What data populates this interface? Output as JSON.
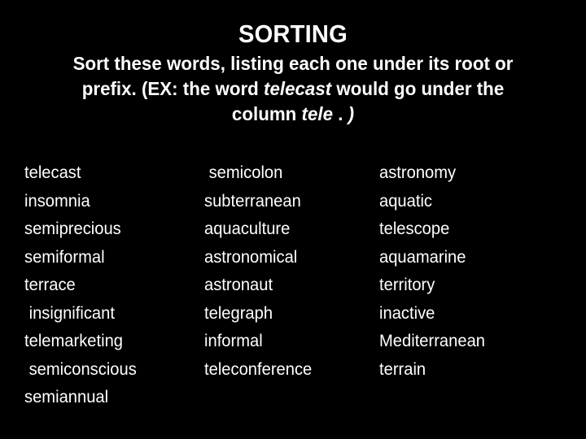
{
  "slide": {
    "title": "SORTING",
    "background_color": "#000000",
    "text_color": "#ffffff",
    "subtitle_lines": [
      {
        "segments": [
          {
            "text": "Sort these words, listing each one under its root or",
            "italic": false
          }
        ]
      },
      {
        "segments": [
          {
            "text": "prefix.  (EX: the word ",
            "italic": false
          },
          {
            "text": "telecast",
            "italic": true
          },
          {
            "text": " would go under the",
            "italic": false
          }
        ]
      },
      {
        "segments": [
          {
            "text": "column ",
            "italic": false
          },
          {
            "text": "tele",
            "italic": true
          },
          {
            "text": " . ",
            "italic": false
          },
          {
            "text": ")",
            "italic": true
          }
        ]
      }
    ]
  },
  "columns": [
    {
      "id": "column-1",
      "words": [
        "telecast",
        "insomnia",
        "semiprecious",
        "semiformal",
        "terrace",
        " insignificant",
        "telemarketing",
        " semiconscious",
        "semiannual"
      ]
    },
    {
      "id": "column-2",
      "words": [
        " semicolon",
        "subterranean",
        "aquaculture",
        "astronomical",
        "astronaut",
        "telegraph",
        "informal",
        "teleconference"
      ]
    },
    {
      "id": "column-3",
      "words": [
        "astronomy",
        "aquatic",
        "telescope",
        "aquamarine",
        "territory",
        "inactive",
        "Mediterranean",
        "terrain"
      ]
    }
  ]
}
